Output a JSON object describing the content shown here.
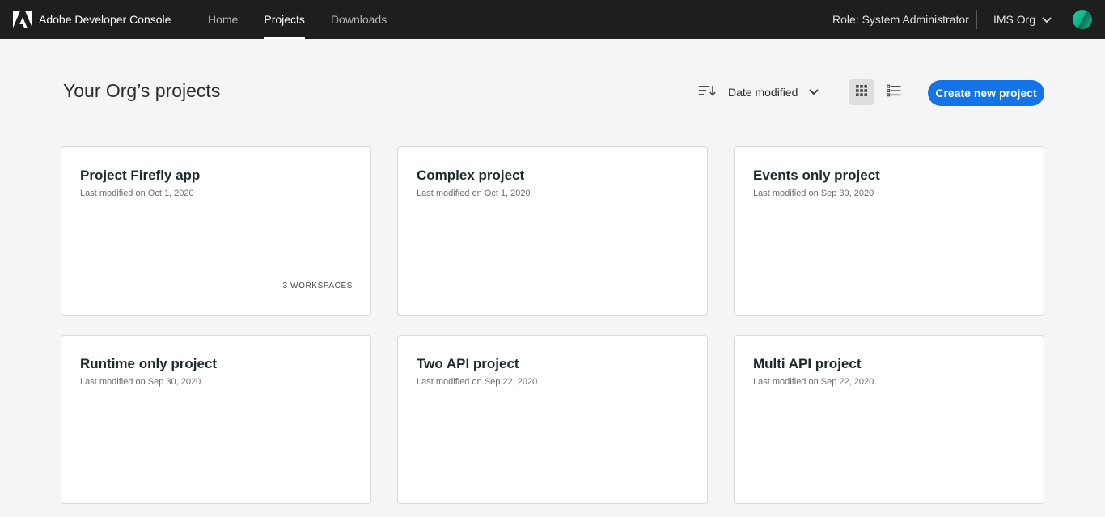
{
  "header": {
    "brand": "Adobe Developer Console",
    "nav": [
      {
        "label": "Home",
        "active": false
      },
      {
        "label": "Projects",
        "active": true
      },
      {
        "label": "Downloads",
        "active": false
      }
    ],
    "role": "Role: System Administrator",
    "org": "IMS Org",
    "icons": {
      "logo": "adobe-logo-icon",
      "org_dropdown": "chevron-down-icon",
      "avatar": "avatar"
    }
  },
  "main": {
    "title": "Your Org’s projects",
    "sort": {
      "label": "Date modified",
      "icon": "sort-icon",
      "dropdown_icon": "chevron-down-icon"
    },
    "view": {
      "selected": "grid",
      "options": [
        "grid-view-icon",
        "list-view-icon"
      ]
    },
    "create_button": "Create new project",
    "cards": [
      {
        "title": "Project Firefly app",
        "modified": "Last modified on Oct 1, 2020",
        "badge": "3 WORKSPACES"
      },
      {
        "title": "Complex project",
        "modified": "Last modified on Oct 1, 2020",
        "badge": ""
      },
      {
        "title": "Events only project",
        "modified": "Last modified on Sep 30, 2020",
        "badge": ""
      },
      {
        "title": "Runtime only project",
        "modified": "Last modified on Sep 30, 2020",
        "badge": ""
      },
      {
        "title": "Two API project",
        "modified": "Last modified on Sep 22, 2020",
        "badge": ""
      },
      {
        "title": "Multi API project",
        "modified": "Last modified on Sep 22, 2020",
        "badge": ""
      }
    ]
  },
  "colors": {
    "topbar": "#1e1e1e",
    "page_background": "#f5f5f5",
    "accent": "#1473e6",
    "card_background": "#ffffff"
  }
}
